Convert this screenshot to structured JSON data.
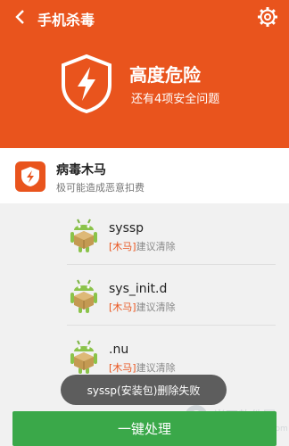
{
  "header": {
    "title": "手机杀毒",
    "back_icon": "back-arrow-icon",
    "settings_icon": "gear-icon",
    "danger_title": "高度危险",
    "danger_subtitle": "还有4项安全问题",
    "color": "#e9541d"
  },
  "section": {
    "title": "病毒木马",
    "subtitle": "极可能造成恶意扣费"
  },
  "items": [
    {
      "name": "syssp",
      "tag": "[木马]",
      "advice": "建议清除"
    },
    {
      "name": "sys_init.d",
      "tag": "[木马]",
      "advice": "建议清除"
    },
    {
      "name": ".nu",
      "tag": "[木马]",
      "advice": "建议清除"
    }
  ],
  "toast": "syssp(安装包)删除失败",
  "action_button": "一键处理",
  "watermark": {
    "text": "当下软件园",
    "url": "www.downxia.com"
  },
  "colors": {
    "accent": "#e9541d",
    "button": "#3aa849"
  }
}
